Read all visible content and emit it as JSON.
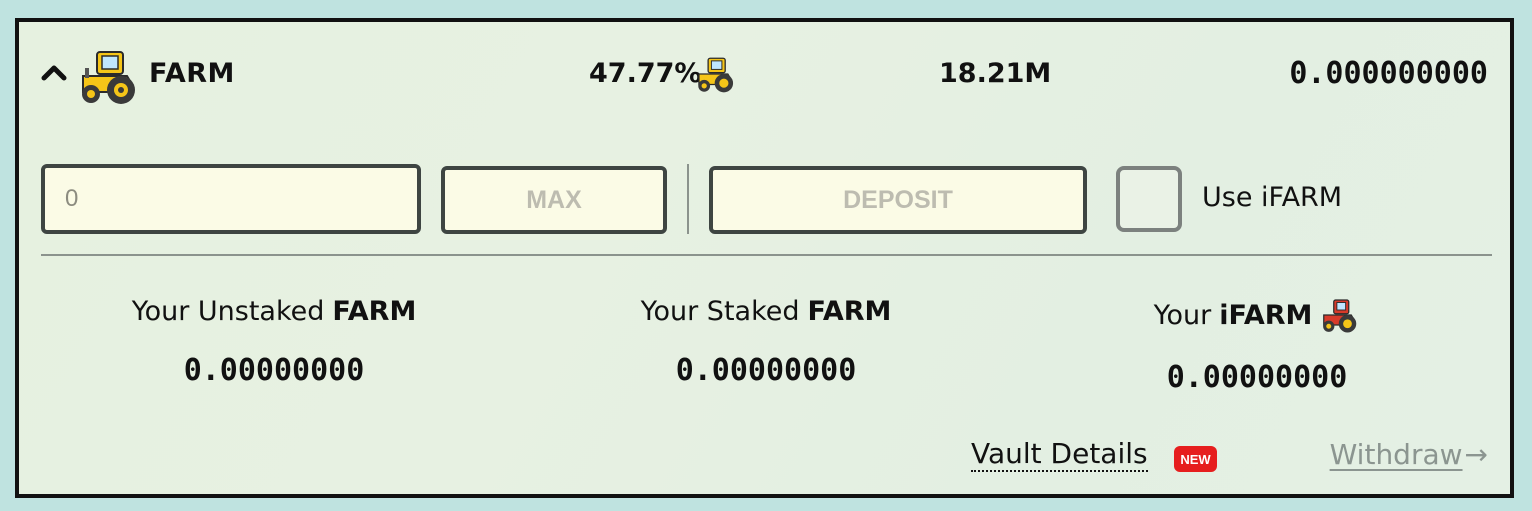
{
  "vault": {
    "name": "FARM",
    "apy": "47.77%",
    "apy_icon": "tractor-icon",
    "tvl": "18.21M",
    "balance": "0.000000000",
    "icon": "tractor-icon"
  },
  "controls": {
    "amount_placeholder": "0",
    "max_label": "MAX",
    "deposit_label": "DEPOSIT",
    "use_ifarm_label": "Use iFARM",
    "use_ifarm_checked": false
  },
  "stats": [
    {
      "prefix": "Your Unstaked",
      "token": "FARM",
      "value": "0.00000000"
    },
    {
      "prefix": "Your Staked",
      "token": "FARM",
      "value": "0.00000000"
    },
    {
      "prefix": "Your",
      "token": "iFARM",
      "value": "0.00000000",
      "icon": "red-tractor-icon"
    }
  ],
  "footer": {
    "vault_details_label": "Vault Details",
    "new_badge": "NEW",
    "withdraw_label": "Withdraw",
    "withdraw_arrow": "→"
  },
  "colors": {
    "accent_badge": "#e61e1e",
    "disabled_text": "#bdbcb0",
    "muted_link": "#8b9590",
    "input_bg": "#fbfbe6"
  }
}
